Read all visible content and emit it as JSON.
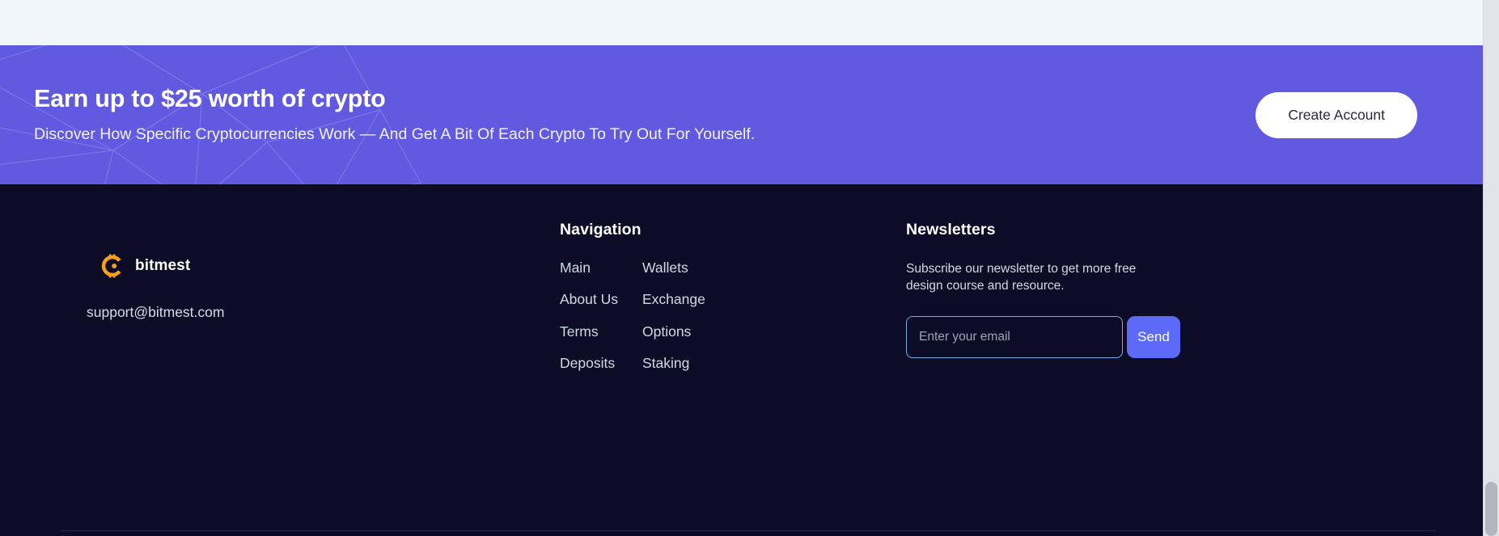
{
  "promo": {
    "title": "Earn up to $25 worth of crypto",
    "subtitle": "Discover How Specific Cryptocurrencies Work — And Get A Bit Of Each Crypto To Try Out For Yourself.",
    "cta_label": "Create Account",
    "background_color": "#6159e0",
    "cta_background": "#ffffff",
    "cta_text_color": "#2a2a3d"
  },
  "footer": {
    "background_color": "#0d0c26",
    "brand": {
      "logo_icon": "bitcoin-coin-icon",
      "logo_color": "#f5a118",
      "name": "bitmest",
      "email": "support@bitmest.com"
    },
    "navigation": {
      "title": "Navigation",
      "links": [
        {
          "label": "Main"
        },
        {
          "label": "Wallets"
        },
        {
          "label": "About Us"
        },
        {
          "label": "Exchange"
        },
        {
          "label": "Terms"
        },
        {
          "label": "Options"
        },
        {
          "label": "Deposits"
        },
        {
          "label": "Staking"
        }
      ]
    },
    "newsletter": {
      "title": "Newsletters",
      "description": "Subscribe our newsletter to get more free design course and resource.",
      "email_placeholder": "Enter your email",
      "email_value": "",
      "send_label": "Send",
      "send_background": "#5d6af8",
      "input_border_color": "#74aee2"
    }
  },
  "chrome": {
    "top_strip_color": "#f1f6fb",
    "scrollbar_track_color": "#e2e4ea",
    "scrollbar_thumb_color": "#b3b6bf"
  }
}
